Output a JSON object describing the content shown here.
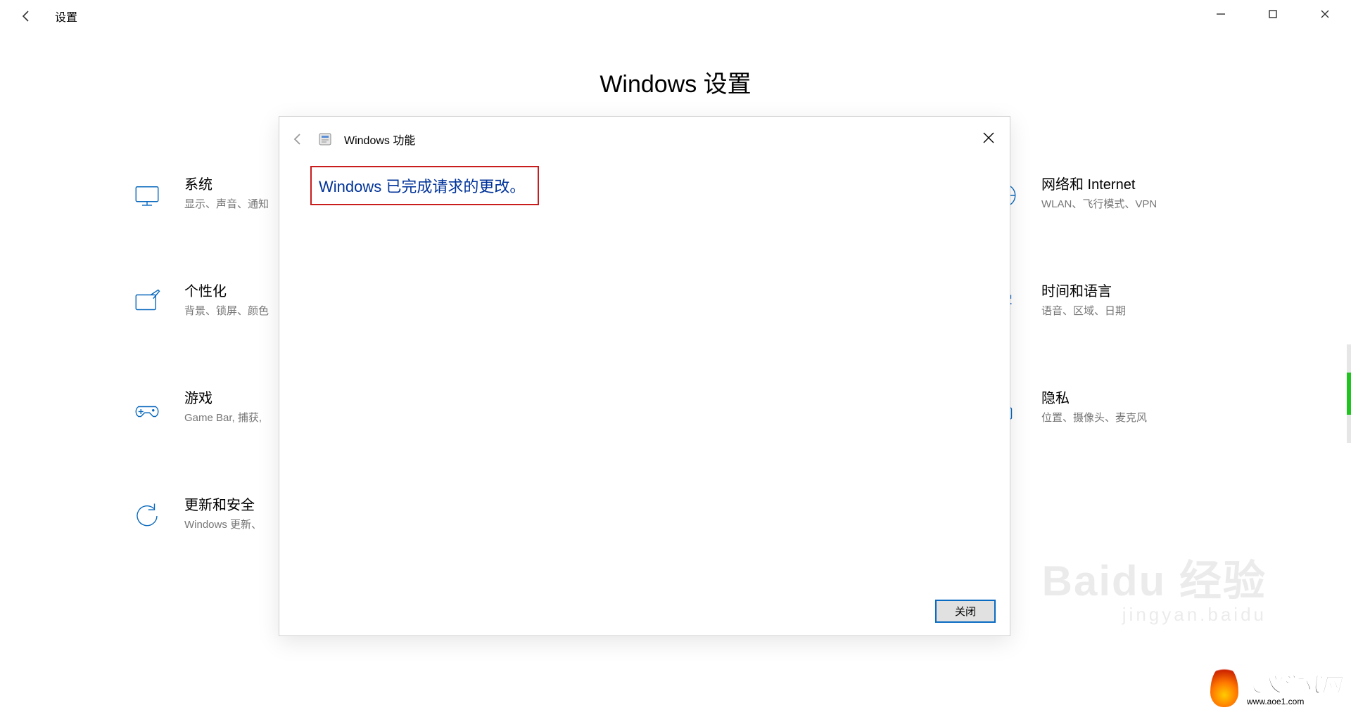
{
  "window": {
    "title": "设置",
    "page_title": "Windows 设置"
  },
  "categories": {
    "system": {
      "title": "系统",
      "subtitle": "显示、声音、通知"
    },
    "network": {
      "title": "网络和 Internet",
      "subtitle": "WLAN、飞行模式、VPN"
    },
    "personal": {
      "title": "个性化",
      "subtitle": "背景、锁屏、颜色"
    },
    "timelang": {
      "title": "时间和语言",
      "subtitle": "语音、区域、日期"
    },
    "gaming": {
      "title": "游戏",
      "subtitle": "Game Bar, 捕获,"
    },
    "privacy": {
      "title": "隐私",
      "subtitle": "位置、摄像头、麦克风"
    },
    "update": {
      "title": "更新和安全",
      "subtitle": "Windows 更新、"
    }
  },
  "dialog": {
    "title": "Windows 功能",
    "message": "Windows 已完成请求的更改。",
    "close_button": "关闭"
  },
  "watermarks": {
    "baidu_main": "Baidu 经验",
    "baidu_sub": "jingyan.baidu",
    "aoe_main": "奥义游戏网",
    "aoe_sub": "www.aoe1.com"
  }
}
